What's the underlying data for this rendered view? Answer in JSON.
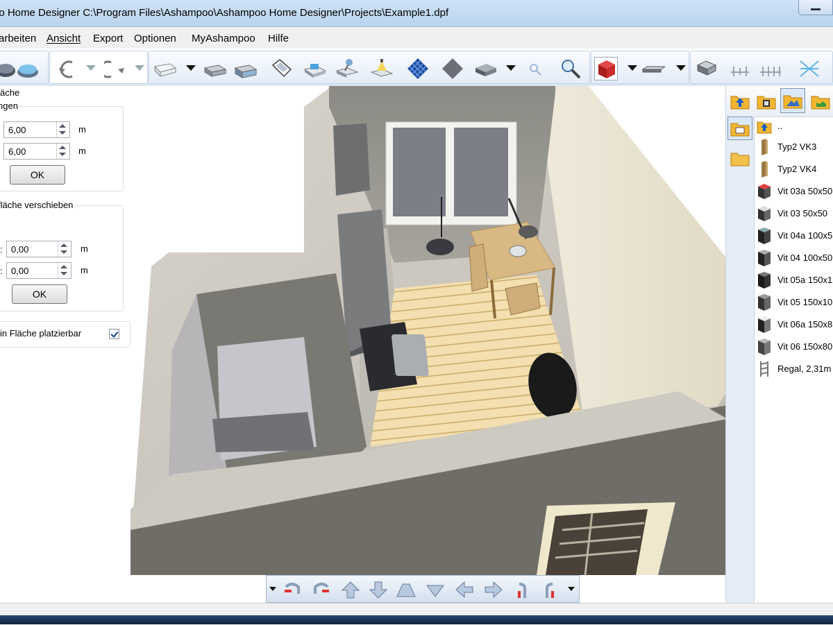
{
  "window": {
    "title": "oo Home Designer C:\\Program Files\\Ashampoo\\Ashampoo Home Designer\\Projects\\Example1.dpf"
  },
  "menu": [
    "arbeiten",
    "Ansicht",
    "Export",
    "Optionen",
    "MyAshampoo",
    "Hilfe"
  ],
  "left_panel": {
    "section_title": "äche",
    "group1": {
      "title": "ngen",
      "width_value": "6,00",
      "width_unit": "m",
      "depth_value": "6,00",
      "depth_unit": "m",
      "ok_label": "OK"
    },
    "group2": {
      "title": "fläche verschieben",
      "x_prefix": ":",
      "x_value": "0,00",
      "x_unit": "m",
      "y_prefix": ":",
      "y_value": "0,00",
      "y_unit": "m",
      "ok_label": "OK"
    },
    "checkbox_label": "in Fläche platzierbar",
    "checkbox_checked": true
  },
  "object_list": {
    "up_entry": "..",
    "items": [
      "Typ2 VK3",
      "Typ2 VK4",
      "Vit 03a 50x50",
      "Vit 03 50x50",
      "Vit 04a 100x5",
      "Vit 04 100x50",
      "Vit 05a 150x1",
      "Vit 05 150x10",
      "Vit 06a 150x8",
      "Vit 06 150x80",
      "Regal, 2,31m"
    ]
  },
  "icons": {
    "toolbar": [
      "house-icon",
      "roof-icon",
      "undo-icon",
      "redo-icon",
      "floor-icon",
      "wall-icon",
      "wall-opening-icon",
      "stair-icon",
      "room-icon",
      "object-icon",
      "light-icon",
      "tile-icon",
      "surface-icon",
      "slab-icon",
      "zoom-small-icon",
      "zoom-icon",
      "material-icon",
      "beam-icon",
      "furniture-icon",
      "dimension-icon",
      "dimension-multi-icon",
      "grid-icon"
    ],
    "navigation": [
      "rotate-left-icon",
      "rotate-right-icon",
      "move-up-icon",
      "move-down-icon",
      "tilt-up-icon",
      "tilt-down-icon",
      "move-left-icon",
      "move-right-icon",
      "turn-left-icon",
      "turn-right-icon"
    ]
  },
  "colors": {
    "title_bar": "#c4daf2",
    "toolbar": "#dbe6f4",
    "wall": "#6f6d66",
    "floor": "#f0d9a6",
    "selection_blue": "#1c3f94"
  }
}
